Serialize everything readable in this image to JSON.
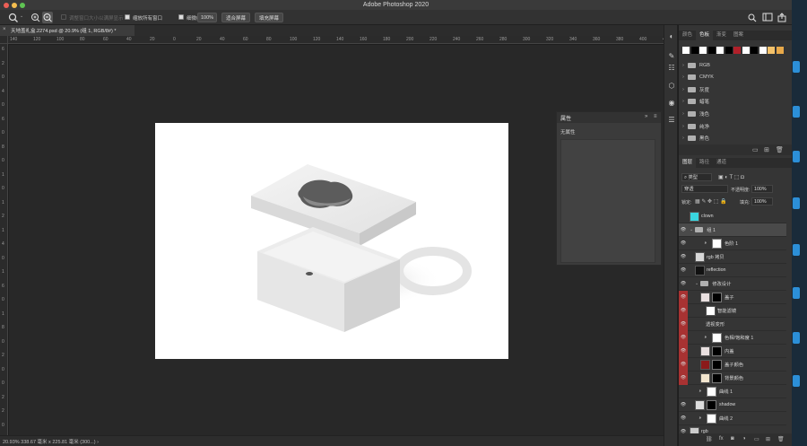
{
  "app": {
    "title": "Adobe Photoshop 2020"
  },
  "options_bar": {
    "tool_icon": "zoom-icon",
    "resize_windows_label": "调整窗口大小以满屏显示",
    "zoom_all_label": "缩放所有窗口",
    "scrubby_zoom_label": "细微缩放",
    "zoom_100": "100%",
    "fit_screen": "适合屏幕",
    "fill_screen": "填充屏幕"
  },
  "document_tab": {
    "title": "天地盖礼盒.2274.psd @ 20.9% (组 1, RGB/8#) *"
  },
  "ruler": {
    "h_ticks": [
      "140",
      "120",
      "100",
      "80",
      "60",
      "40",
      "20",
      "0",
      "20",
      "40",
      "60",
      "80",
      "100",
      "120",
      "140",
      "160",
      "180",
      "200",
      "220",
      "240",
      "260",
      "280",
      "300",
      "320",
      "340",
      "360",
      "380",
      "400",
      "420"
    ],
    "v_ticks": [
      "6",
      "2",
      "0",
      "4",
      "0",
      "6",
      "0",
      "8",
      "0",
      "1",
      "0",
      "1",
      "2",
      "1",
      "4",
      "0",
      "1",
      "6",
      "0",
      "1",
      "8",
      "0",
      "2",
      "0",
      "0",
      "2",
      "2",
      "0"
    ]
  },
  "status_bar": {
    "text": "20.93%   338.67 毫米 x 225.81 毫米 (300...)  ›"
  },
  "properties_panel": {
    "title": "属性",
    "body": "无属性"
  },
  "swatches_panel": {
    "tabs": [
      "颜色",
      "色板",
      "渐变",
      "图案"
    ],
    "active_tab": "色板",
    "colors": [
      "#ffffff",
      "#000000",
      "#ffffff",
      "#000000",
      "#ffffff",
      "#000000",
      "#b0202a",
      "#ffffff",
      "#000000",
      "#ffffff",
      "#f5c26a",
      "#e8a94a"
    ],
    "folders": [
      "RGB",
      "CMYK",
      "灰度",
      "蜡笔",
      "浅色",
      "纯净",
      "黑色"
    ]
  },
  "layers_panel": {
    "tabs": [
      "图层",
      "路径",
      "通道"
    ],
    "active_tab": "图层",
    "kind_label": "类型",
    "blend_mode": "穿透",
    "opacity_label": "不透明度:",
    "opacity_value": "100%",
    "lock_label": "锁定:",
    "fill_label": "填充:",
    "fill_value": "100%",
    "layers": [
      {
        "name": "clown",
        "thumb": "#3ad6e0",
        "visible": false,
        "indent": 0,
        "mask": false,
        "selected": false
      },
      {
        "name": "组 1",
        "thumb": "folder",
        "visible": true,
        "indent": 0,
        "mask": false,
        "selected": true
      },
      {
        "name": "色阶 1",
        "thumb": "adjust",
        "visible": true,
        "indent": 2,
        "mask": true,
        "selected": false
      },
      {
        "name": "rgb 拷贝",
        "thumb": "#d8d8d8",
        "visible": true,
        "indent": 1,
        "mask": false,
        "selected": false
      },
      {
        "name": "reflection",
        "thumb": "#111111",
        "visible": true,
        "indent": 1,
        "mask": false,
        "selected": false
      },
      {
        "name": "修改设计",
        "thumb": "folder",
        "visible": true,
        "indent": 1,
        "mask": false,
        "selected": false
      },
      {
        "name": "盖子",
        "thumb": "#e9e0e0",
        "visible": true,
        "indent": 2,
        "mask": true,
        "selected": false,
        "red": true
      },
      {
        "name": "智能滤镜",
        "thumb": "#ffffff",
        "visible": true,
        "indent": 3,
        "mask": false,
        "selected": false,
        "red": true
      },
      {
        "name": "透视变形",
        "thumb": "none",
        "visible": true,
        "indent": 3,
        "mask": false,
        "selected": false,
        "red": true
      },
      {
        "name": "色相/饱和度 1",
        "thumb": "adjust",
        "visible": true,
        "indent": 2,
        "mask": true,
        "selected": false,
        "red": true
      },
      {
        "name": "内盖",
        "thumb": "#e9e0e0",
        "visible": true,
        "indent": 2,
        "mask": true,
        "selected": false,
        "red": true
      },
      {
        "name": "盖子颜色",
        "thumb": "#8b1a1a",
        "visible": true,
        "indent": 2,
        "mask": true,
        "selected": false,
        "red": true
      },
      {
        "name": "背景颜色",
        "thumb": "#f3e6cf",
        "visible": true,
        "indent": 2,
        "mask": true,
        "selected": false,
        "red": true
      },
      {
        "name": "曲线 1",
        "thumb": "adjust",
        "visible": false,
        "indent": 1,
        "mask": true,
        "selected": false
      },
      {
        "name": "shadow",
        "thumb": "#dddddd",
        "visible": true,
        "indent": 1,
        "mask": true,
        "selected": false
      },
      {
        "name": "曲线 2",
        "thumb": "adjust",
        "visible": true,
        "indent": 1,
        "mask": true,
        "selected": false
      },
      {
        "name": "rgb",
        "thumb": "#cccccc",
        "visible": true,
        "indent": 0,
        "mask": false,
        "selected": false
      }
    ]
  }
}
